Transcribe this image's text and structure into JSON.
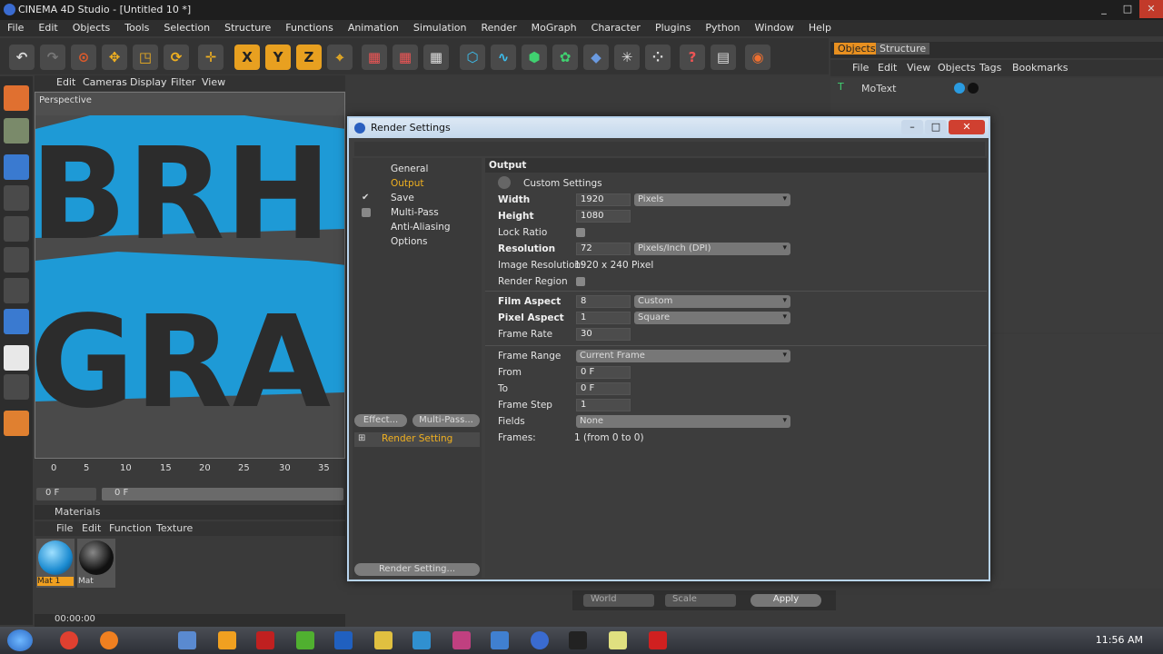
{
  "app": {
    "title": "CINEMA 4D Studio - [Untitled 10 *]",
    "window_buttons": [
      "_",
      "□",
      "✕"
    ]
  },
  "menu": [
    "File",
    "Edit",
    "Objects",
    "Tools",
    "Selection",
    "Structure",
    "Functions",
    "Animation",
    "Simulation",
    "Render",
    "MoGraph",
    "Character",
    "Plugins",
    "Python",
    "Window",
    "Help"
  ],
  "viewport": {
    "menu": [
      "Edit",
      "Cameras",
      "Display",
      "Filter",
      "View"
    ],
    "label": "Perspective"
  },
  "timeline": {
    "ticks": [
      "0",
      "5",
      "10",
      "15",
      "20",
      "25",
      "30",
      "35"
    ],
    "frame_value": "0 F",
    "slider_value": "0 F"
  },
  "materials": {
    "header": "Materials",
    "menu": [
      "File",
      "Edit",
      "Function",
      "Texture"
    ],
    "items": [
      {
        "label": "Mat 1",
        "color": "#2a9be0"
      },
      {
        "label": "Mat",
        "color": "#1a1a1a"
      }
    ]
  },
  "status": {
    "time": "00:00:00"
  },
  "object_manager": {
    "tabs": [
      "Objects",
      "Structure"
    ],
    "menu": [
      "File",
      "Edit",
      "View",
      "Objects",
      "Tags",
      "Bookmarks"
    ],
    "objects": [
      {
        "name": "MoText"
      }
    ]
  },
  "coord_bar": {
    "world": "World",
    "scale": "Scale",
    "apply": "Apply"
  },
  "dialog": {
    "title": "Render Settings",
    "nav": [
      {
        "label": "General",
        "selected": false
      },
      {
        "label": "Output",
        "selected": true
      },
      {
        "label": "Save",
        "selected": false,
        "checked": true
      },
      {
        "label": "Multi-Pass",
        "selected": false,
        "checked": false
      },
      {
        "label": "Anti-Aliasing",
        "selected": false
      },
      {
        "label": "Options",
        "selected": false
      }
    ],
    "effect_button": "Effect...",
    "multipass_button": "Multi-Pass...",
    "render_setting_item": "Render Setting",
    "render_setting_button": "Render Setting...",
    "section": "Output",
    "custom_settings": "Custom Settings",
    "width": {
      "label": "Width",
      "value": "1920",
      "unit": "Pixels"
    },
    "height": {
      "label": "Height",
      "value": "1080"
    },
    "lock_ratio": {
      "label": "Lock Ratio"
    },
    "resolution": {
      "label": "Resolution",
      "value": "72",
      "unit": "Pixels/Inch (DPI)"
    },
    "image_resolution": {
      "label": "Image Resolution:",
      "value": "1920 x 240 Pixel"
    },
    "render_region": {
      "label": "Render Region"
    },
    "film_aspect": {
      "label": "Film Aspect",
      "value": "8",
      "preset": "Custom"
    },
    "pixel_aspect": {
      "label": "Pixel Aspect",
      "value": "1",
      "preset": "Square"
    },
    "frame_rate": {
      "label": "Frame Rate",
      "value": "30"
    },
    "frame_range": {
      "label": "Frame Range",
      "value": "Current Frame"
    },
    "from": {
      "label": "From",
      "value": "0 F"
    },
    "to": {
      "label": "To",
      "value": "0 F"
    },
    "frame_step": {
      "label": "Frame Step",
      "value": "1"
    },
    "fields": {
      "label": "Fields",
      "value": "None"
    },
    "frames": {
      "label": "Frames:",
      "value": "1 (from 0 to 0)"
    }
  },
  "taskbar": {
    "time": "11:56 AM"
  }
}
